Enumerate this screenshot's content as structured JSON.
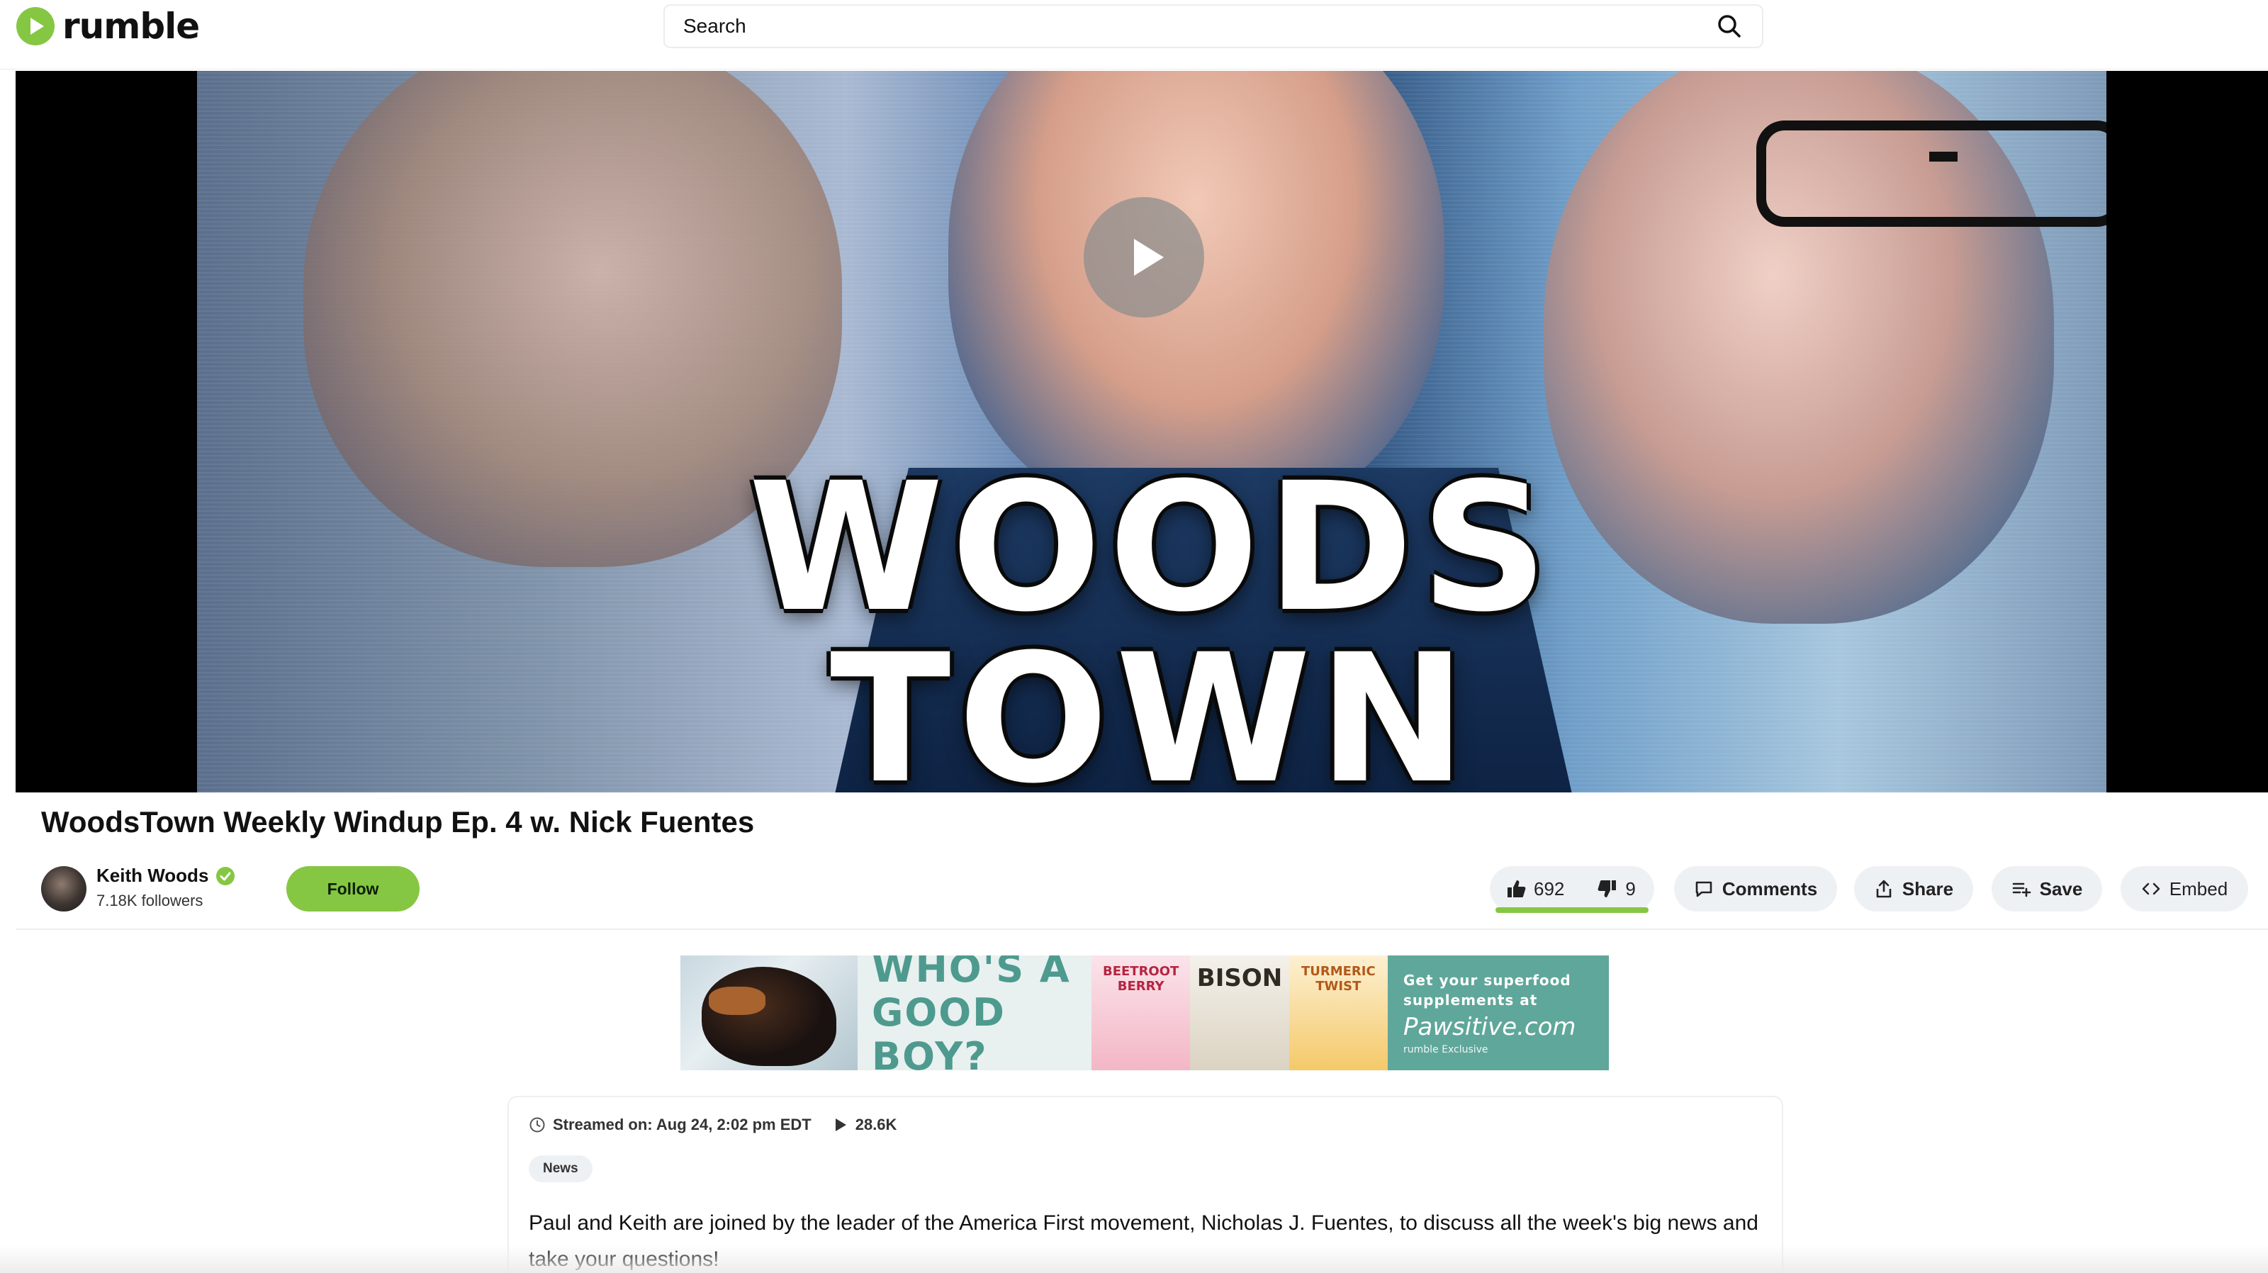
{
  "header": {
    "logo_text": "rumble",
    "search": {
      "placeholder": "Search"
    }
  },
  "player": {
    "thumbnail_title_line1": "WOODS",
    "thumbnail_title_line2": "TOWN"
  },
  "video": {
    "title": "WoodsTown Weekly Windup Ep. 4 w. Nick Fuentes",
    "channel": {
      "name": "Keith Woods",
      "followers": "7.18K followers",
      "follow_label": "Follow"
    },
    "actions": {
      "likes": "692",
      "dislikes": "9",
      "comments_label": "Comments",
      "share_label": "Share",
      "save_label": "Save",
      "embed_label": "Embed"
    }
  },
  "ad": {
    "headline_line1": "WHO'S A",
    "headline_line2": "GOOD BOY?",
    "product1": "BEETROOT BERRY",
    "product2": "BISON",
    "product3": "TURMERIC TWIST",
    "cta_line": "Get your superfood supplements at",
    "cta_brand": "Pawsitive.com",
    "cta_sub": "rumble Exclusive"
  },
  "description": {
    "streamed": "Streamed on: Aug 24, 2:02 pm EDT",
    "views": "28.6K",
    "tag": "News",
    "text": "Paul and Keith are joined by the leader of the America First movement, Nicholas J. Fuentes, to discuss all the week's big news and take your questions!"
  },
  "colors": {
    "brand_green": "#85c742",
    "verified_green": "#85c742",
    "pill_bg": "#eef1f4",
    "ad_teal": "#5fa79a"
  }
}
